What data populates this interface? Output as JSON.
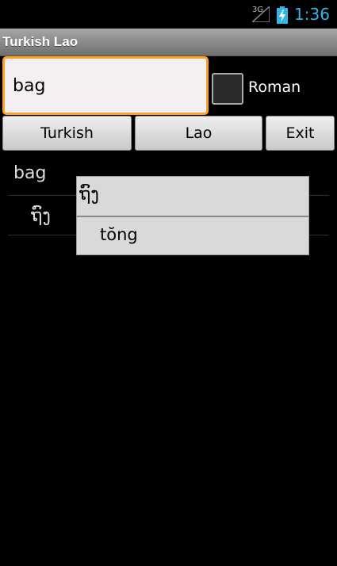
{
  "status_bar": {
    "network_label": "3G",
    "time": "1:36",
    "accent": "#33b5e5"
  },
  "app": {
    "title": "Turkish Lao"
  },
  "search": {
    "value": "bag"
  },
  "roman": {
    "label": "Roman",
    "checked": false
  },
  "buttons": {
    "turkish": "Turkish",
    "lao": "Lao",
    "exit": "Exit"
  },
  "results": [
    {
      "text": "bag"
    },
    {
      "text": "ຖົງ"
    }
  ],
  "popup": {
    "lao": "ຖົງ",
    "romanized": "tŏng"
  },
  "colors": {
    "input_border": "#ffa020",
    "background": "#000000"
  }
}
